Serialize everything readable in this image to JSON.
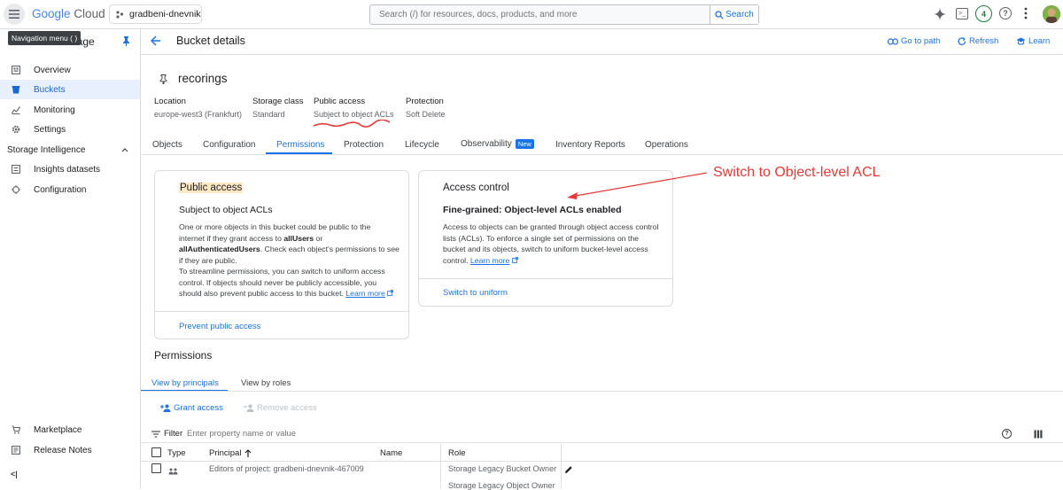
{
  "topbar": {
    "brand_google": "Google",
    "brand_cloud": "Cloud",
    "project": "gradbeni-dnevnik",
    "search_placeholder": "Search (/) for resources, docs, products, and more",
    "search_button": "Search",
    "notif_count": "4"
  },
  "tooltip": "Navigation menu ( )",
  "sidebar": {
    "product_title": "Cloud Storage",
    "items": [
      {
        "label": "Overview",
        "icon": "overview-icon"
      },
      {
        "label": "Buckets",
        "icon": "bucket-icon"
      },
      {
        "label": "Monitoring",
        "icon": "monitoring-icon"
      },
      {
        "label": "Settings",
        "icon": "gear-icon"
      }
    ],
    "section": "Storage Intelligence",
    "section_items": [
      {
        "label": "Insights datasets",
        "icon": "dataset-icon"
      },
      {
        "label": "Configuration",
        "icon": "configuration-icon"
      }
    ],
    "bottom_items": [
      {
        "label": "Marketplace",
        "icon": "cart-icon"
      },
      {
        "label": "Release Notes",
        "icon": "notes-icon"
      }
    ],
    "collapse": "<|"
  },
  "header": {
    "title": "Bucket details",
    "goto": "Go to path",
    "refresh": "Refresh",
    "learn": "Learn"
  },
  "bucket": {
    "name": "recorings",
    "props": [
      {
        "label": "Location",
        "value": "europe-west3 (Frankfurt)"
      },
      {
        "label": "Storage class",
        "value": "Standard"
      },
      {
        "label": "Public access",
        "value": "Subject to object ACLs"
      },
      {
        "label": "Protection",
        "value": "Soft Delete"
      }
    ]
  },
  "tabs": [
    "Objects",
    "Configuration",
    "Permissions",
    "Protection",
    "Lifecycle",
    "Observability",
    "Inventory Reports",
    "Operations"
  ],
  "new_badge": "New",
  "public_card": {
    "title": "Public access",
    "subtitle": "Subject to object ACLs",
    "l1": "One or more objects in this bucket could be public to the",
    "l2a": "internet if they grant access to ",
    "l2b": "allUsers",
    "l2c": " or",
    "l3a": "allAuthenticatedUsers",
    "l3b": ". Check each object's permissions to see",
    "l4": "if they are public.",
    "l5": "To streamline permissions, you can switch to uniform access",
    "l6": "control. If objects should never be publicly accessible, you",
    "l7": "should also prevent public access to this bucket. ",
    "learn": "Learn more",
    "action": "Prevent public access"
  },
  "access_card": {
    "title": "Access control",
    "subtitle": "Fine-grained: Object-level ACLs enabled",
    "l1": "Access to objects can be granted through object access control",
    "l2": "lists (ACLs). To enforce a single set of permissions on the",
    "l3": "bucket and its objects, switch to uniform bucket-level access",
    "l4": "control. ",
    "learn": "Learn more",
    "action": "Switch to uniform"
  },
  "annotation": "Switch to Object-level ACL",
  "permissions": {
    "title": "Permissions",
    "view_principals": "View by principals",
    "view_roles": "View by roles",
    "grant": "Grant access",
    "remove": "Remove access",
    "filter_label": "Filter",
    "filter_placeholder": "Enter property name or value",
    "columns": [
      "Type",
      "Principal",
      "Name",
      "Role"
    ],
    "rows": [
      {
        "principal": "Editors of project: gradbeni-dnevnik-467009",
        "name": "",
        "roles": [
          "Storage Legacy Bucket Owner",
          "Storage Legacy Object Owner"
        ]
      }
    ]
  },
  "colors": {
    "accent": "#1a73e8",
    "annotation": "#e53935",
    "active_bg": "#e8f0fe",
    "highlight": "#fde8c4"
  }
}
